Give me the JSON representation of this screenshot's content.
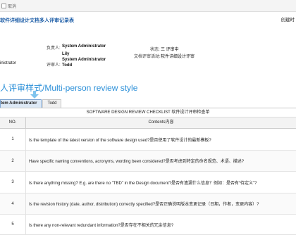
{
  "toolbar": {
    "back_label": "取消"
  },
  "header": {
    "title": "软件详细设计文档多人评审记录表",
    "creator": "创建时"
  },
  "form": {
    "left_value": "inistrator",
    "owner_label": "负责人:",
    "owner_value": "System Administrator",
    "reviewers_label": "评审人:",
    "reviewers": [
      "Lily",
      "System Administrator",
      "Todd"
    ],
    "status_label": "状态:",
    "status_value": "三 评审中",
    "activity_label": "文档评审活动:",
    "activity_value": "软件详细设计评审"
  },
  "section": {
    "title": "人评审样式/Multi-person review style"
  },
  "tabs": [
    {
      "label": "tem Administrator",
      "active": true
    },
    {
      "label": "Todd",
      "active": false
    }
  ],
  "checklist": {
    "title": "SOFTWARE DESIGN REVIEW CHECKLIST 软件设计评审检查单",
    "col_no": "NO.",
    "col_contents": "Contents内容",
    "rows": [
      {
        "no": "1",
        "text": "Is the template of the latest version of the software design used?是否使用了软件设计的最新模板?"
      },
      {
        "no": "2",
        "text": "Have specific naming conventions, acronyms, wording been considered?是否考虑到特定的命名规范、术语、描述?"
      },
      {
        "no": "3",
        "text": "Is there anything missing? E.g. are there no \"TBD\" in the Design document?是否有遗漏什么信息？例如：是否有“待定义”?"
      },
      {
        "no": "4",
        "text": "Is the revision history (date, author, distribution) correctly specified?是否正确说明版本变更记录（日期，作者，变更内容）?"
      },
      {
        "no": "5",
        "text": "Is there any non-relevant redundant information?是否存在不相关的冗余信息?"
      }
    ]
  },
  "colors": {
    "accent": "#2b8fd8",
    "title_blue": "#1f5fa8"
  }
}
